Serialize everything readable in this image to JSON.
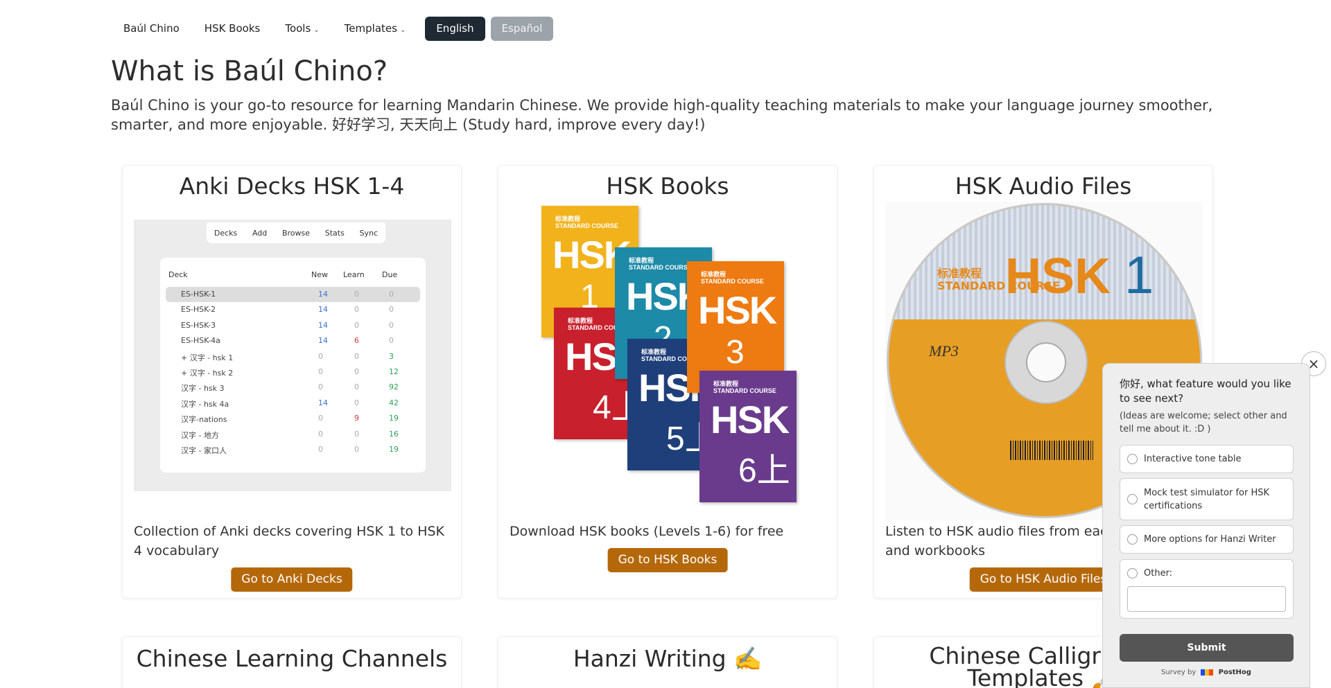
{
  "nav": {
    "items": [
      {
        "label": "Baúl Chino",
        "has_caret": false
      },
      {
        "label": "HSK Books",
        "has_caret": false
      },
      {
        "label": "Tools",
        "has_caret": true
      },
      {
        "label": "Templates",
        "has_caret": true
      }
    ],
    "caret": "⌄",
    "lang_en": "English",
    "lang_es": "Español"
  },
  "hero": {
    "title": "What is Baúl Chino?",
    "description": "Baúl Chino is your go-to resource for learning Mandarin Chinese. We provide high-quality teaching materials to make your language journey smoother, smarter, and more enjoyable. 好好学习, 天天向上 (Study hard, improve every day!)"
  },
  "cards": {
    "anki": {
      "title": "Anki Decks HSK 1-4",
      "description": "Collection of Anki decks covering HSK 1 to HSK 4 vocabulary",
      "button": "Go to Anki Decks",
      "image": {
        "tabs": [
          "Decks",
          "Add",
          "Browse",
          "Stats",
          "Sync"
        ],
        "headers": {
          "deck": "Deck",
          "new": "New",
          "learn": "Learn",
          "due": "Due"
        },
        "rows": [
          {
            "deck": "ES-HSK-1",
            "new": "14",
            "learn": "0",
            "due": "0",
            "selected": true
          },
          {
            "deck": "ES-HSK-2",
            "new": "14",
            "learn": "0",
            "due": "0"
          },
          {
            "deck": "ES-HSK-3",
            "new": "14",
            "learn": "0",
            "due": "0"
          },
          {
            "deck": "ES-HSK-4a",
            "new": "14",
            "learn": "6",
            "due": "0"
          },
          {
            "deck": "+ 汉字 - hsk 1",
            "new": "0",
            "learn": "0",
            "due": "3"
          },
          {
            "deck": "+ 汉字 - hsk 2",
            "new": "0",
            "learn": "0",
            "due": "12"
          },
          {
            "deck": "汉字 - hsk 3",
            "new": "0",
            "learn": "0",
            "due": "92"
          },
          {
            "deck": "汉字 - hsk 4a",
            "new": "14",
            "learn": "0",
            "due": "42"
          },
          {
            "deck": "汉字-nations",
            "new": "0",
            "learn": "9",
            "due": "19"
          },
          {
            "deck": "汉字 - 地方",
            "new": "0",
            "learn": "0",
            "due": "16"
          },
          {
            "deck": "汉字 - 家口人",
            "new": "0",
            "learn": "0",
            "due": "19"
          }
        ]
      }
    },
    "books": {
      "title": "HSK Books",
      "description": "Download HSK books (Levels 1-6) for free",
      "button": "Go to HSK Books",
      "image": {
        "standard": "标准教程",
        "course": "STANDARD COURSE",
        "hsk": "HSK",
        "levels": [
          "1",
          "2",
          "3",
          "4上",
          "5上",
          "6上"
        ],
        "colors": [
          "#f2b21c",
          "#1d8aa8",
          "#ee7a12",
          "#c8202c",
          "#1f3f7a",
          "#6a3b8c"
        ]
      }
    },
    "audio": {
      "title": "HSK Audio Files",
      "description": "Listen to HSK audio files from each textbooks and workbooks",
      "button": "Go to HSK Audio Files",
      "image": {
        "standard": "标准教程",
        "course": "STANDARD COURSE",
        "hsk": "HSK",
        "level": "1",
        "mp3": "MP3"
      }
    },
    "channels": {
      "title": "Chinese Learning Channels"
    },
    "hanzi": {
      "title": "Hanzi Writing ✍️"
    },
    "calligraphy": {
      "title": "Chinese Calligraphy Templates 🖌️"
    }
  },
  "survey": {
    "close": "×",
    "question": "你好, what feature would you like to see next?",
    "subtitle": "(Ideas are welcome; select other and tell me about it. :D )",
    "options": [
      "Interactive tone table",
      "Mock test simulator for HSK certifications",
      "More options for Hanzi Writer",
      "Other:"
    ],
    "submit": "Submit",
    "footer_prefix": "Survey by",
    "footer_brand": "PostHog"
  }
}
